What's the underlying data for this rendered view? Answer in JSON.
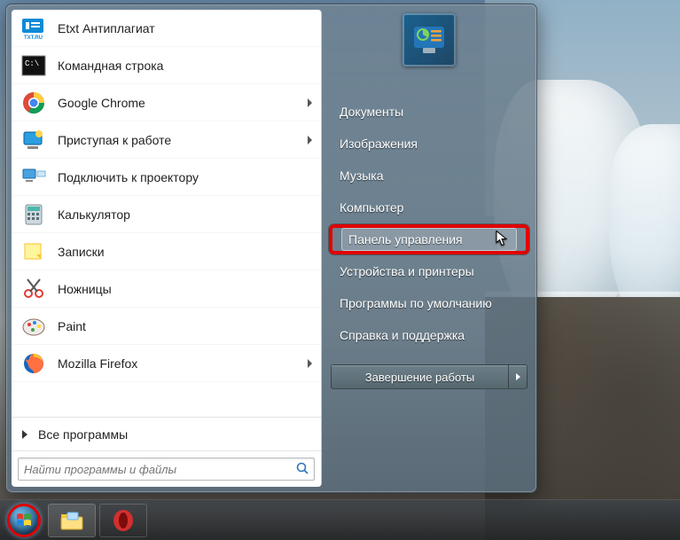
{
  "left_items": [
    {
      "label": "Etxt Антиплагиат",
      "icon": "etxt"
    },
    {
      "label": "Командная строка",
      "icon": "cmd"
    },
    {
      "label": "Google Chrome",
      "icon": "chrome",
      "has_arrow": true
    },
    {
      "label": "Приступая к работе",
      "icon": "getting-started",
      "has_arrow": true
    },
    {
      "label": "Подключить к проектору",
      "icon": "projector"
    },
    {
      "label": "Калькулятор",
      "icon": "calc"
    },
    {
      "label": "Записки",
      "icon": "sticky"
    },
    {
      "label": "Ножницы",
      "icon": "snip"
    },
    {
      "label": "Paint",
      "icon": "paint"
    },
    {
      "label": "Mozilla Firefox",
      "icon": "firefox",
      "has_arrow": true
    }
  ],
  "all_programs_label": "Все программы",
  "search_placeholder": "Найти программы и файлы",
  "right_links": [
    {
      "label": "Документы"
    },
    {
      "label": "Изображения"
    },
    {
      "label": "Музыка"
    },
    {
      "label": "Компьютер"
    },
    {
      "label": "Панель управления",
      "highlighted": true
    },
    {
      "label": "Устройства и принтеры"
    },
    {
      "label": "Программы по умолчанию"
    },
    {
      "label": "Справка и поддержка"
    }
  ],
  "shutdown_label": "Завершение работы"
}
